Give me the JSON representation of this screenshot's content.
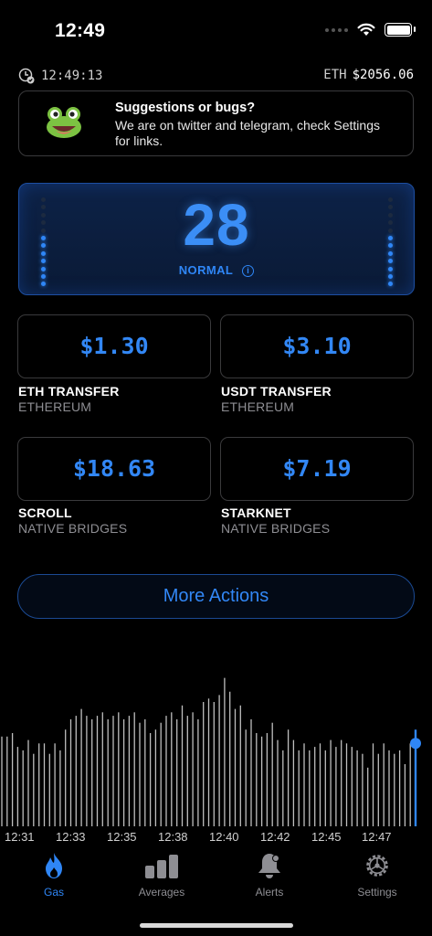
{
  "status_bar": {
    "time": "12:49"
  },
  "info_row": {
    "clock": "12:49:13",
    "eth_label": "ETH",
    "eth_price": "$2056.06"
  },
  "banner": {
    "title": "Suggestions or bugs?",
    "body": "We are on twitter and telegram, check Settings for links."
  },
  "gas": {
    "value": "28",
    "status": "NORMAL",
    "info_glyph": "i",
    "meter_level": 0.55
  },
  "tiles": [
    {
      "price": "$1.30",
      "title": "ETH TRANSFER",
      "subtitle": "ETHEREUM"
    },
    {
      "price": "$3.10",
      "title": "USDT TRANSFER",
      "subtitle": "ETHEREUM"
    },
    {
      "price": "$18.63",
      "title": "SCROLL",
      "subtitle": "NATIVE BRIDGES"
    },
    {
      "price": "$7.19",
      "title": "STARKNET",
      "subtitle": "NATIVE BRIDGES"
    }
  ],
  "more_actions": {
    "label": "More Actions"
  },
  "chart_data": {
    "type": "bar",
    "x_tick_labels": [
      "12:31",
      "12:33",
      "12:35",
      "12:38",
      "12:40",
      "12:42",
      "12:45",
      "12:47"
    ],
    "values": [
      26,
      26,
      27,
      23,
      22,
      25,
      21,
      24,
      24,
      21,
      24,
      22,
      28,
      31,
      32,
      34,
      32,
      31,
      32,
      33,
      31,
      32,
      33,
      31,
      32,
      33,
      30,
      31,
      27,
      28,
      30,
      32,
      33,
      31,
      35,
      32,
      33,
      31,
      36,
      37,
      36,
      38,
      43,
      39,
      34,
      35,
      28,
      31,
      27,
      26,
      27,
      30,
      25,
      22,
      28,
      25,
      22,
      24,
      22,
      23,
      24,
      22,
      25,
      23,
      25,
      24,
      23,
      22,
      21,
      17,
      24,
      21,
      24,
      22,
      21,
      22,
      18,
      24,
      28
    ],
    "y_max": 45,
    "bar_color": "#ffffff",
    "highlight_color": "#2f86f6",
    "current_value": 24
  },
  "tab_bar": {
    "tabs": [
      {
        "label": "Gas",
        "icon": "flame-icon",
        "active": true
      },
      {
        "label": "Averages",
        "icon": "bar-chart-icon",
        "active": false
      },
      {
        "label": "Alerts",
        "icon": "bell-icon",
        "active": false
      },
      {
        "label": "Settings",
        "icon": "gear-icon",
        "active": false
      }
    ]
  },
  "colors": {
    "accent": "#2f86f6",
    "card_bg": "#0d2247",
    "border": "#3a3a3c"
  }
}
